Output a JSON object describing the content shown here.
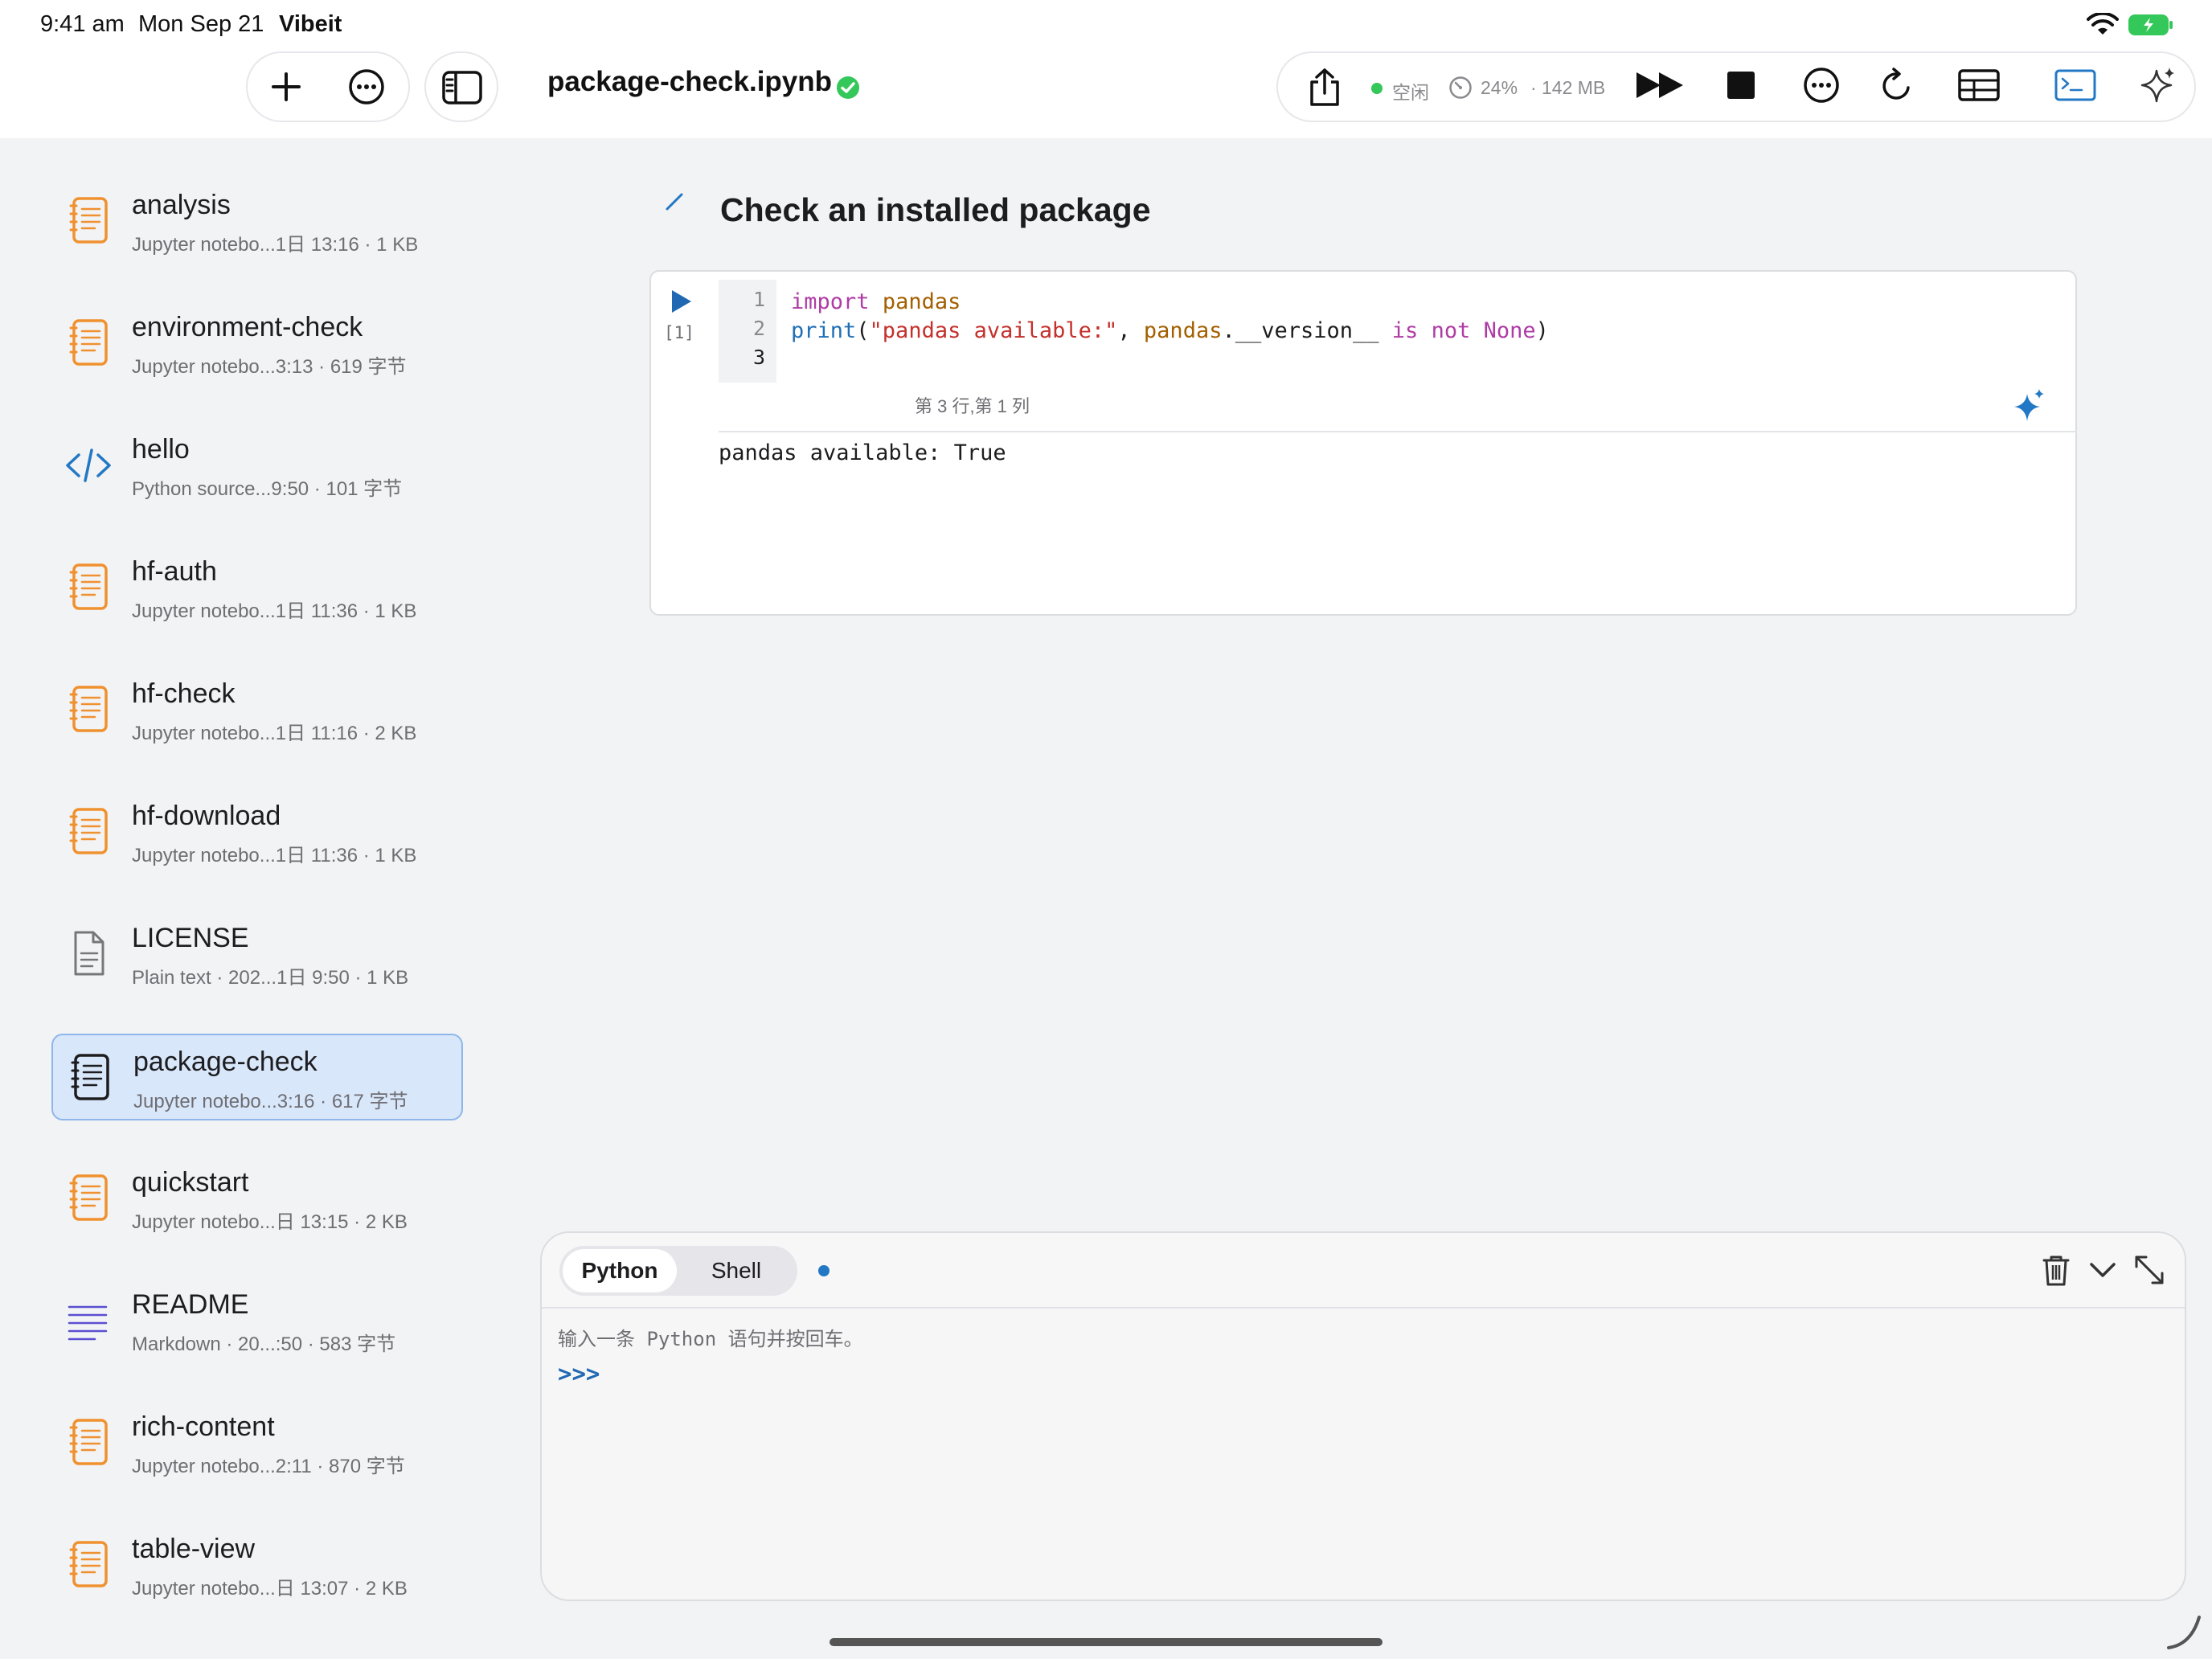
{
  "status_bar": {
    "time": "9:41 am",
    "date": "Mon Sep 21",
    "app": "Vibeit"
  },
  "toolbar": {
    "notebook_title": "package-check.ipynb",
    "kernel_state": "空闲",
    "cpu": "24%",
    "separator": "·",
    "memory": "142 MB"
  },
  "sidebar": {
    "files": [
      {
        "name": "analysis",
        "meta": "Jupyter notebo...1日 13:16 · 1 KB",
        "icon": "notebook-icon"
      },
      {
        "name": "environment-check",
        "meta": "Jupyter notebo...3:13 · 619 字节",
        "icon": "notebook-icon"
      },
      {
        "name": "hello",
        "meta": "Python source...9:50 · 101 字节",
        "icon": "code-icon"
      },
      {
        "name": "hf-auth",
        "meta": "Jupyter notebo...1日 11:36 · 1 KB",
        "icon": "notebook-icon"
      },
      {
        "name": "hf-check",
        "meta": "Jupyter notebo...1日 11:16 · 2 KB",
        "icon": "notebook-icon"
      },
      {
        "name": "hf-download",
        "meta": "Jupyter notebo...1日 11:36 · 1 KB",
        "icon": "notebook-icon"
      },
      {
        "name": "LICENSE",
        "meta": "Plain text · 202...1日 9:50 · 1 KB",
        "icon": "text-file-icon"
      },
      {
        "name": "package-check",
        "meta": "Jupyter notebo...3:16 · 617 字节",
        "icon": "notebook-icon",
        "selected": true
      },
      {
        "name": "quickstart",
        "meta": "Jupyter notebo...日 13:15 · 2 KB",
        "icon": "notebook-icon"
      },
      {
        "name": "README",
        "meta": "Markdown · 20...:50 · 583 字节",
        "icon": "markdown-icon"
      },
      {
        "name": "rich-content",
        "meta": "Jupyter notebo...2:11 · 870 字节",
        "icon": "notebook-icon"
      },
      {
        "name": "table-view",
        "meta": "Jupyter notebo...日 13:07 · 2 KB",
        "icon": "notebook-icon"
      }
    ]
  },
  "notebook": {
    "markdown_heading": "Check an installed package",
    "cell": {
      "execution_count": "[1]",
      "line_numbers": [
        "1",
        "2",
        "3"
      ],
      "code": {
        "line1": {
          "kw": "import",
          "mod": "pandas"
        },
        "line2": {
          "fn": "print",
          "open": "(",
          "str": "\"pandas available:\"",
          "comma": ", ",
          "var": "pandas",
          "attr": ".__version__ ",
          "is": "is",
          "space1": " ",
          "not": "not",
          "space2": " ",
          "none": "None",
          "close": ")"
        }
      },
      "cursor_position": "第 3 行,第 1 列",
      "output": "pandas available: True"
    }
  },
  "console": {
    "tabs": [
      "Python",
      "Shell"
    ],
    "active_tab": "Python",
    "hint": "输入一条 Python 语句并按回车。",
    "prompt": ">>>"
  },
  "colors": {
    "accent": "#2278c4",
    "kernel_idle": "#34c759",
    "notebook_icon": "#f0912f",
    "selected_bg": "#d9e7fb"
  }
}
